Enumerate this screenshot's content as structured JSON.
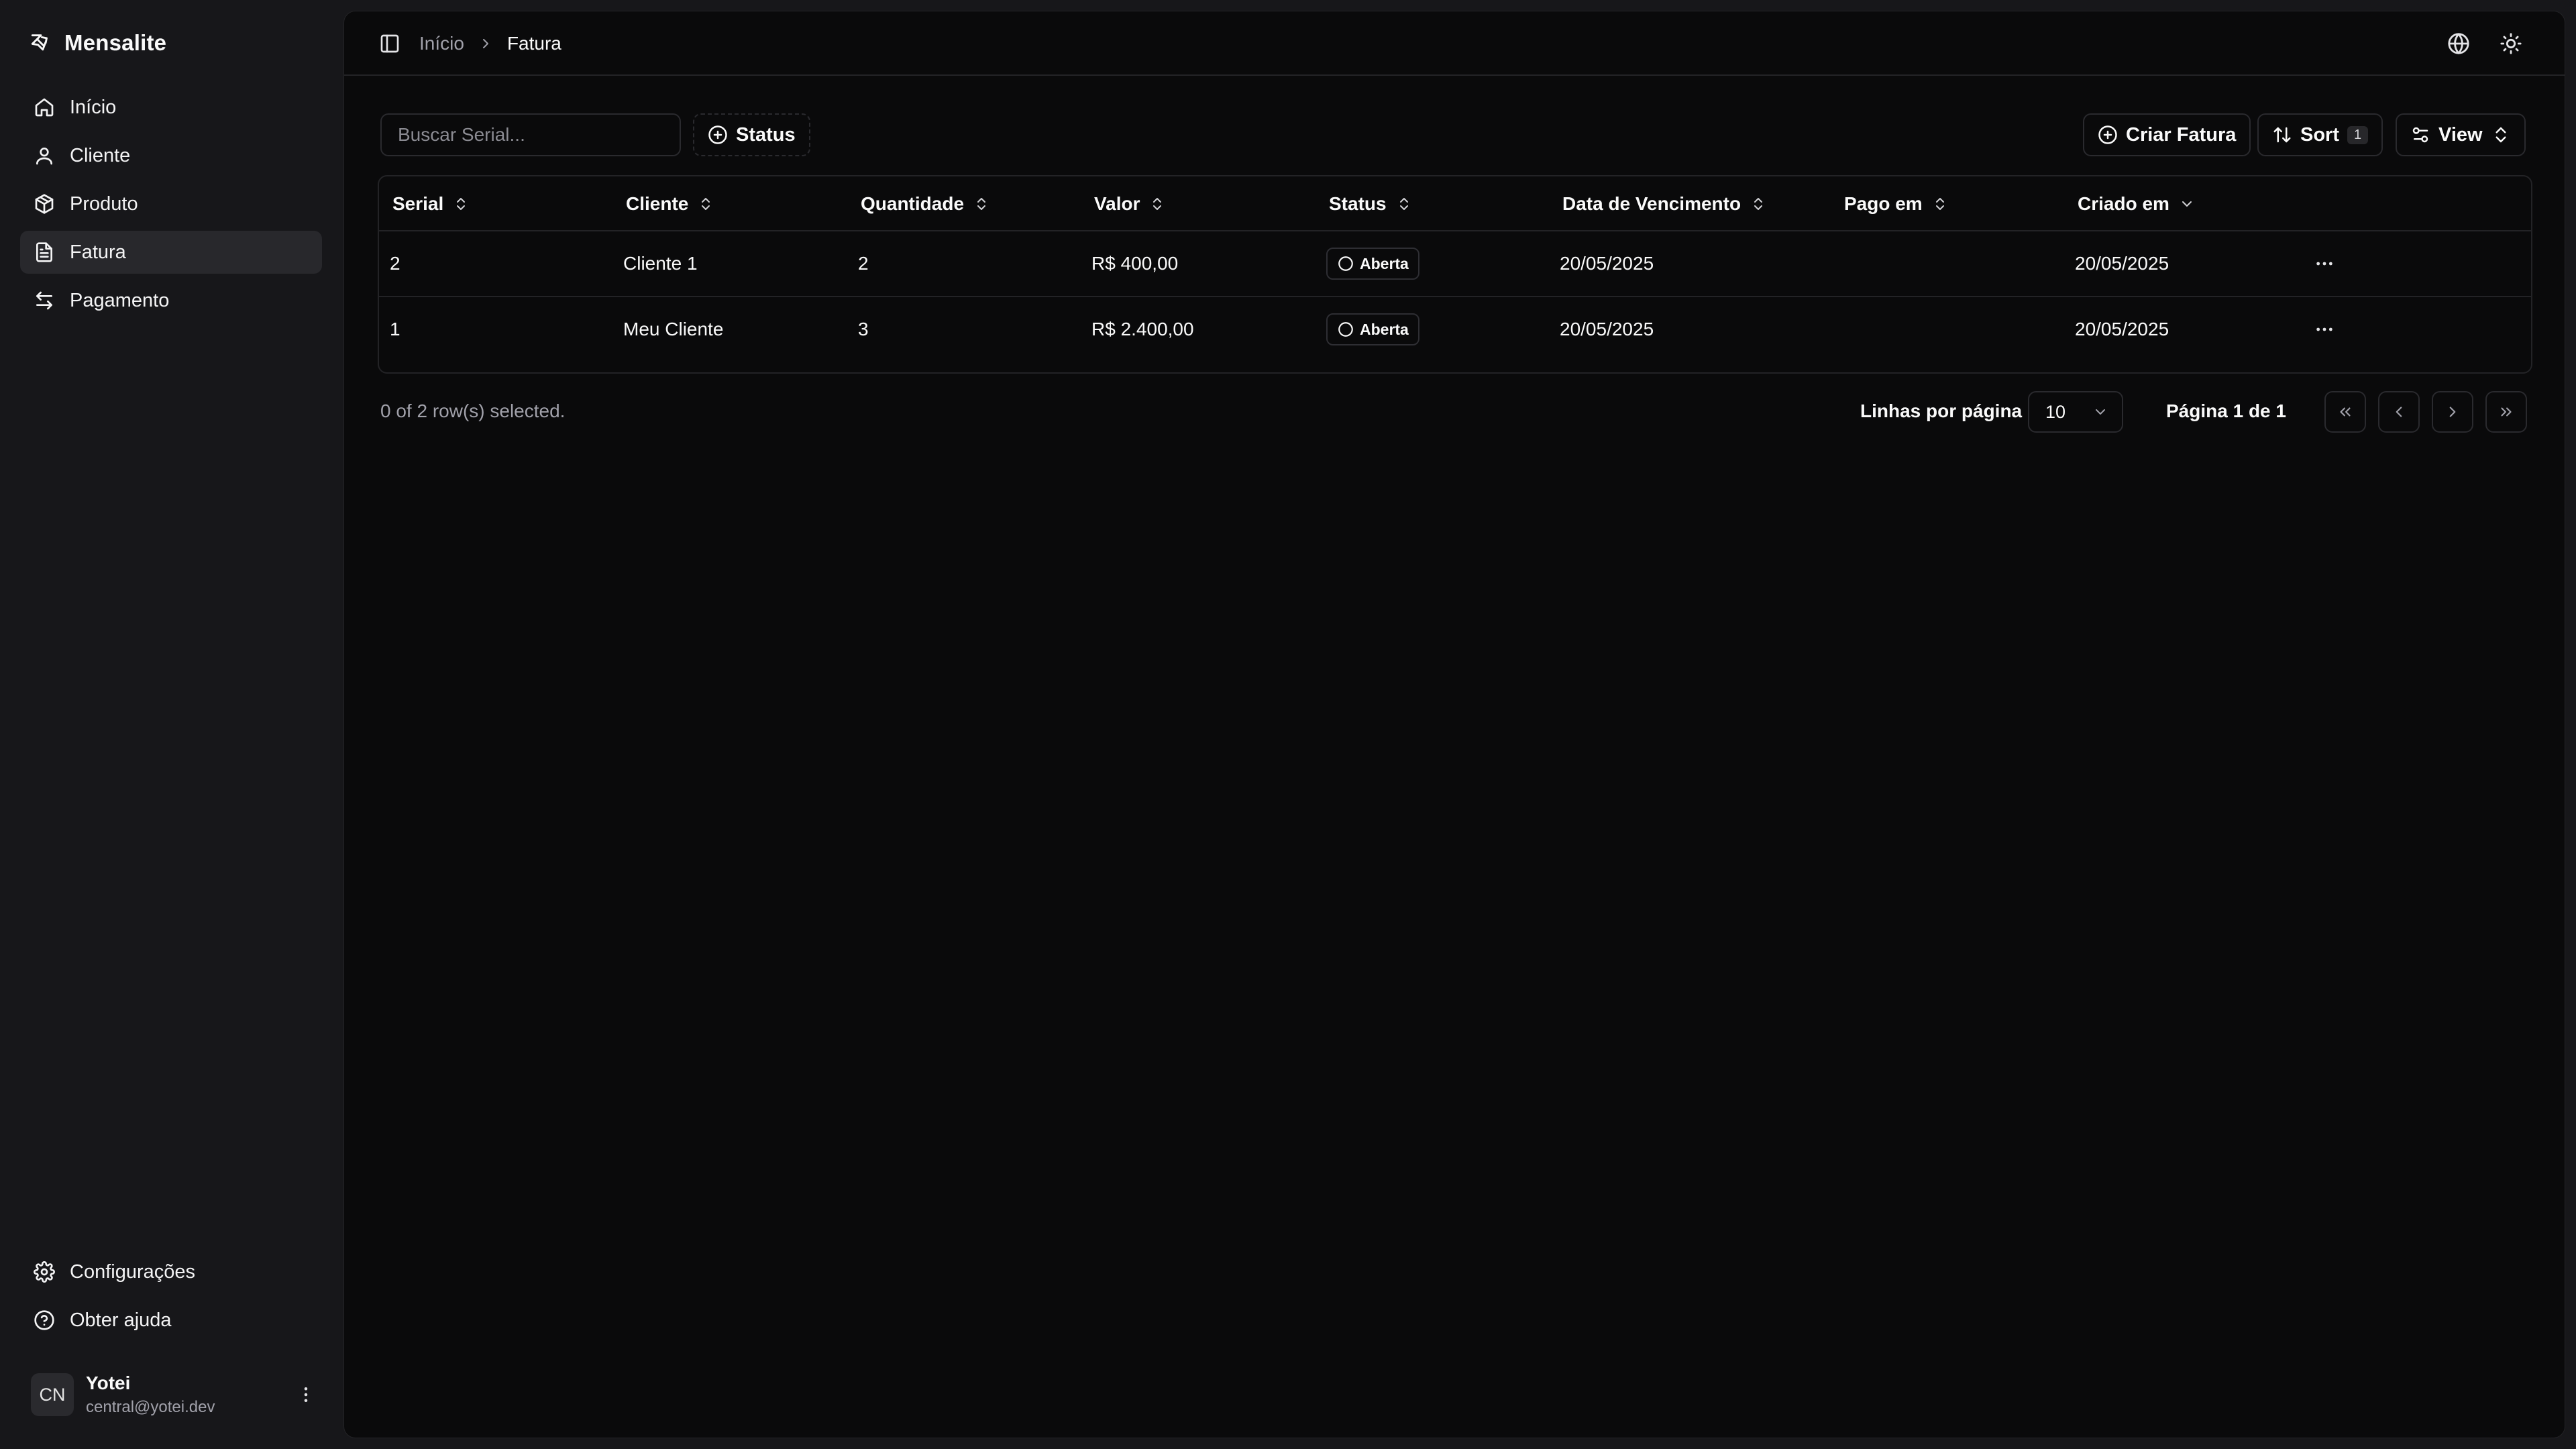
{
  "app": {
    "name": "Mensalite"
  },
  "sidebar": {
    "items": [
      {
        "label": "Início",
        "icon": "home-icon"
      },
      {
        "label": "Cliente",
        "icon": "user-icon"
      },
      {
        "label": "Produto",
        "icon": "package-icon"
      },
      {
        "label": "Fatura",
        "icon": "file-text-icon",
        "active": true
      },
      {
        "label": "Pagamento",
        "icon": "arrows-exchange-icon"
      }
    ],
    "footer_items": [
      {
        "label": "Configurações",
        "icon": "gear-icon"
      },
      {
        "label": "Obter ajuda",
        "icon": "help-circle-icon"
      }
    ],
    "user": {
      "initials": "CN",
      "name": "Yotei",
      "email": "central@yotei.dev"
    }
  },
  "header": {
    "breadcrumb": {
      "parent": "Início",
      "current": "Fatura"
    }
  },
  "toolbar": {
    "search_placeholder": "Buscar Serial...",
    "status_filter_label": "Status",
    "create_label": "Criar Fatura",
    "sort_label": "Sort",
    "sort_count": "1",
    "view_label": "View"
  },
  "table": {
    "columns": [
      "Serial",
      "Cliente",
      "Quantidade",
      "Valor",
      "Status",
      "Data de Vencimento",
      "Pago em",
      "Criado em"
    ],
    "rows": [
      {
        "serial": "2",
        "cliente": "Cliente 1",
        "quantidade": "2",
        "valor": "R$ 400,00",
        "status": "Aberta",
        "vencimento": "20/05/2025",
        "pago_em": "",
        "criado_em": "20/05/2025"
      },
      {
        "serial": "1",
        "cliente": "Meu Cliente",
        "quantidade": "3",
        "valor": "R$ 2.400,00",
        "status": "Aberta",
        "vencimento": "20/05/2025",
        "pago_em": "",
        "criado_em": "20/05/2025"
      }
    ]
  },
  "pagination": {
    "selected_text": "0 of 2 row(s) selected.",
    "rows_per_page_label": "Linhas por página",
    "rows_per_page_value": "10",
    "page_text": "Página 1 de 1"
  },
  "colors": {
    "background": "#17171a",
    "panel": "#0a0a0b",
    "border": "#232326",
    "active_item": "#28282c",
    "muted_text": "#a1a1aa"
  }
}
